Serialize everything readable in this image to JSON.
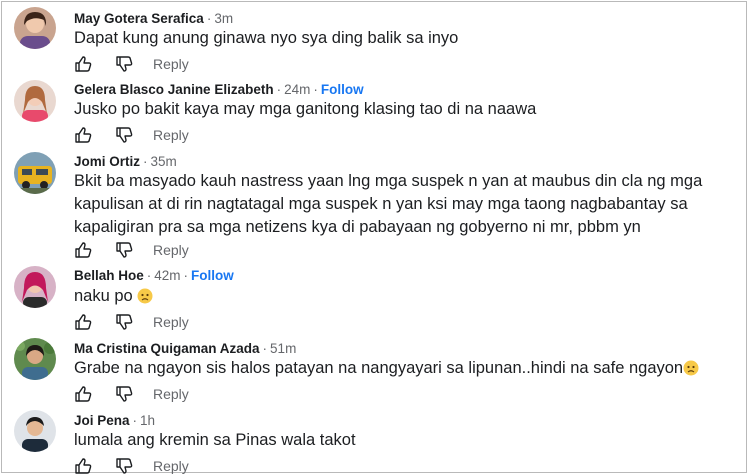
{
  "comments": [
    {
      "author": "May Gotera Serafica",
      "time": "3m",
      "follow": "",
      "text": "Dapat kung anung ginawa nyo sya ding balik sa inyo",
      "reply": "Reply"
    },
    {
      "author": "Gelera Blasco Janine Elizabeth",
      "time": "24m",
      "follow": "Follow",
      "text": "Jusko po bakit kaya may mga ganitong klasing tao di na naawa",
      "reply": "Reply"
    },
    {
      "author": "Jomi Ortiz",
      "time": "35m",
      "follow": "",
      "text": "Bkit ba masyado kauh nastress yaan lng mga suspek n yan at maubus din cla ng mga kapulisan at di rin nagtatagal mga suspek n yan ksi may mga taong nagbabantay sa kapaligiran pra sa mga netizens kya di pabayaan ng gobyerno ni mr, pbbm yn",
      "reply": "Reply"
    },
    {
      "author": "Bellah Hoe",
      "time": "42m",
      "follow": "Follow",
      "text": "naku po",
      "reply": "Reply"
    },
    {
      "author": "Ma Cristina Quigaman Azada",
      "time": "51m",
      "follow": "",
      "text": "Grabe na ngayon sis halos patayan na nangyayari sa lipunan..hindi na safe ngayon",
      "reply": "Reply"
    },
    {
      "author": "Joi Pena",
      "time": "1h",
      "follow": "",
      "text": "lumala ang kremin sa Pinas wala takot",
      "reply": "Reply"
    }
  ],
  "separator": "·",
  "icons": {
    "like": "thumbs-up-icon",
    "dislike": "thumbs-down-icon",
    "emoji": "worried-face-emoji"
  },
  "colors": {
    "link": "#1877f2",
    "muted": "#65676b",
    "text": "#1c1e21"
  }
}
